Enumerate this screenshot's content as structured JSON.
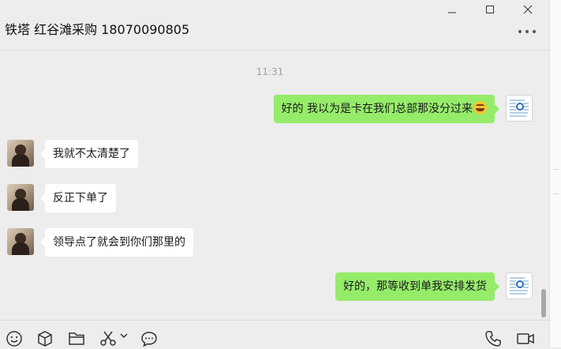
{
  "header": {
    "title": "铁塔 红谷滩采购 18070090805"
  },
  "window_controls": [
    "minimize-icon",
    "maximize-icon",
    "close-icon"
  ],
  "colors": {
    "outgoing_bubble": "#95ec69",
    "incoming_bubble": "#ffffff",
    "background": "#ededed"
  },
  "messages": {
    "timestamp": "11:31",
    "m1": {
      "sender": "me",
      "text": "好的 我以为是卡在我们总部那没分过来"
    },
    "m2": {
      "sender": "them",
      "text": "我就不太清楚了"
    },
    "m3": {
      "sender": "them",
      "text": "反正下单了"
    },
    "m4": {
      "sender": "them",
      "text": "领导点了就会到你们那里的"
    },
    "m5": {
      "sender": "me",
      "text": "好的，那等收到单我安排发货"
    }
  },
  "toolbar": {
    "left_icons": [
      "emoji-icon",
      "package-icon",
      "folder-icon",
      "scissors-icon",
      "chevron-down-icon",
      "chat-bubble-icon"
    ],
    "right_icons": [
      "phone-icon",
      "video-icon"
    ]
  }
}
